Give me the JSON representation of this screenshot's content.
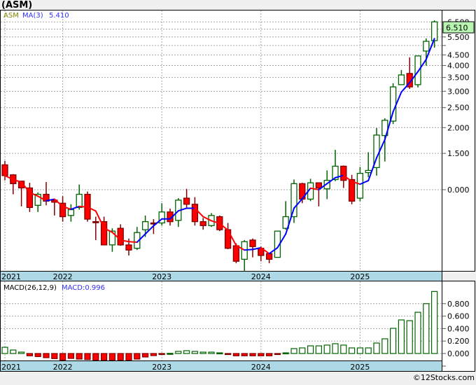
{
  "title": "(ASM)",
  "footer": "©12Stocks.com",
  "colors": {
    "up": "#006400",
    "down": "#ff0000",
    "down_border": "#800000",
    "ma_up": "#0000ff",
    "ma_down": "#ff0000",
    "date_bar": "#add8e6",
    "last_price_box": "#b8f5b0"
  },
  "chart_data": [
    {
      "type": "candlestick",
      "legend": {
        "symbol": "ASM",
        "ma_label": "MA(3)",
        "ma_value": "5.410"
      },
      "last_price": "6.510",
      "y_scale": "log",
      "grid": true,
      "x_tick_labels": [
        "2021",
        "2022",
        "2023",
        "2024",
        "2025"
      ],
      "x_ticks": [
        "2021-06",
        "2022-01",
        "2023-01",
        "2024-01",
        "2025-01"
      ],
      "y_ticks": [
        {
          "value": 6.5,
          "label": "6.500"
        },
        {
          "value": 6.0,
          "label": ""
        },
        {
          "value": 5.5,
          "label": "5.500"
        },
        {
          "value": 5.0,
          "label": ""
        },
        {
          "value": 4.5,
          "label": "4.500"
        },
        {
          "value": 4.0,
          "label": "4.000"
        },
        {
          "value": 3.5,
          "label": "3.500"
        },
        {
          "value": 3.0,
          "label": "3.000"
        },
        {
          "value": 2.5,
          "label": "2.500"
        },
        {
          "value": 2.0,
          "label": "2.000"
        },
        {
          "value": 1.5,
          "label": "1.500"
        },
        {
          "value": 1.0,
          "label": "0.000"
        }
      ],
      "ma_period": 3,
      "candles": [
        [
          "2021-06",
          1.32,
          1.38,
          1.11,
          1.17
        ],
        [
          "2021-07",
          1.18,
          1.19,
          0.95,
          1.07
        ],
        [
          "2021-08",
          1.1,
          1.1,
          0.83,
          1.02
        ],
        [
          "2021-09",
          1.02,
          1.08,
          0.78,
          0.82
        ],
        [
          "2021-10",
          0.84,
          0.97,
          0.78,
          0.95
        ],
        [
          "2021-11",
          0.95,
          1.09,
          0.84,
          0.88
        ],
        [
          "2021-12",
          0.89,
          0.9,
          0.75,
          0.87
        ],
        [
          "2022-01",
          0.86,
          0.93,
          0.7,
          0.74
        ],
        [
          "2022-02",
          0.75,
          0.85,
          0.7,
          0.8
        ],
        [
          "2022-03",
          0.82,
          1.06,
          0.8,
          0.95
        ],
        [
          "2022-04",
          0.95,
          0.98,
          0.7,
          0.72
        ],
        [
          "2022-05",
          0.7,
          0.74,
          0.57,
          0.695
        ],
        [
          "2022-06",
          0.7,
          0.74,
          0.54,
          0.54
        ],
        [
          "2022-07",
          0.54,
          0.65,
          0.5,
          0.63
        ],
        [
          "2022-08",
          0.65,
          0.68,
          0.535,
          0.54
        ],
        [
          "2022-09",
          0.54,
          0.58,
          0.48,
          0.51
        ],
        [
          "2022-10",
          0.52,
          0.66,
          0.51,
          0.62
        ],
        [
          "2022-11",
          0.64,
          0.75,
          0.59,
          0.7
        ],
        [
          "2022-12",
          0.69,
          0.72,
          0.61,
          0.685
        ],
        [
          "2023-01",
          0.69,
          0.86,
          0.67,
          0.78
        ],
        [
          "2023-02",
          0.78,
          0.81,
          0.67,
          0.7
        ],
        [
          "2023-03",
          0.71,
          0.91,
          0.66,
          0.89
        ],
        [
          "2023-04",
          0.91,
          1.01,
          0.82,
          0.85
        ],
        [
          "2023-05",
          0.85,
          0.92,
          0.67,
          0.7
        ],
        [
          "2023-06",
          0.7,
          0.73,
          0.64,
          0.67
        ],
        [
          "2023-07",
          0.67,
          0.77,
          0.66,
          0.75
        ],
        [
          "2023-08",
          0.74,
          0.75,
          0.63,
          0.64
        ],
        [
          "2023-09",
          0.64,
          0.69,
          0.515,
          0.52
        ],
        [
          "2023-10",
          0.535,
          0.55,
          0.44,
          0.45
        ],
        [
          "2023-11",
          0.46,
          0.57,
          0.4,
          0.56
        ],
        [
          "2023-12",
          0.57,
          0.58,
          0.47,
          0.53
        ],
        [
          "2024-01",
          0.52,
          0.53,
          0.45,
          0.48
        ],
        [
          "2024-02",
          0.49,
          0.49,
          0.44,
          0.46
        ],
        [
          "2024-03",
          0.47,
          0.63,
          0.47,
          0.63
        ],
        [
          "2024-04",
          0.65,
          0.88,
          0.64,
          0.74
        ],
        [
          "2024-05",
          0.74,
          1.12,
          0.69,
          1.07
        ],
        [
          "2024-06",
          1.07,
          1.08,
          0.86,
          0.9
        ],
        [
          "2024-07",
          0.9,
          1.13,
          0.88,
          1.08
        ],
        [
          "2024-08",
          1.08,
          1.08,
          0.83,
          1.02
        ],
        [
          "2024-09",
          1.01,
          1.24,
          0.9,
          1.11
        ],
        [
          "2024-10",
          1.12,
          1.56,
          1.1,
          1.3
        ],
        [
          "2024-11",
          1.3,
          1.31,
          1.02,
          1.11
        ],
        [
          "2024-12",
          1.12,
          1.18,
          0.85,
          0.88
        ],
        [
          "2025-01",
          0.91,
          1.29,
          0.88,
          1.2
        ],
        [
          "2025-02",
          1.21,
          1.52,
          1.15,
          1.24
        ],
        [
          "2025-03",
          1.28,
          1.99,
          1.17,
          1.84
        ],
        [
          "2025-04",
          1.83,
          2.22,
          1.37,
          2.17
        ],
        [
          "2025-05",
          2.15,
          3.28,
          2.08,
          3.15
        ],
        [
          "2025-06",
          3.23,
          3.8,
          3.23,
          3.6
        ],
        [
          "2025-07",
          3.66,
          4.38,
          3.08,
          3.15
        ],
        [
          "2025-08",
          3.23,
          4.45,
          3.13,
          4.45
        ],
        [
          "2025-09",
          4.7,
          5.41,
          3.99,
          5.24
        ],
        [
          "2025-10",
          5.28,
          6.62,
          4.88,
          6.51
        ]
      ]
    },
    {
      "type": "bar",
      "legend": {
        "label": "MACD(26,12,9)",
        "value_label": "MACD:0.996"
      },
      "y_ticks": [
        {
          "value": 0.8,
          "label": "0.800"
        },
        {
          "value": 0.6,
          "label": "0.600"
        },
        {
          "value": 0.4,
          "label": "0.400"
        },
        {
          "value": 0.2,
          "label": "0.200"
        },
        {
          "value": 0.0,
          "label": "0.000"
        }
      ],
      "x_tick_labels": [
        "2021",
        "2022",
        "2023",
        "2024",
        "2025"
      ],
      "values": [
        0.1,
        0.056,
        0.022,
        -0.037,
        -0.049,
        -0.067,
        -0.082,
        -0.105,
        -0.079,
        -0.09,
        -0.097,
        -0.108,
        -0.108,
        -0.108,
        -0.108,
        -0.108,
        -0.09,
        -0.056,
        -0.034,
        -0.011,
        0.003,
        0.034,
        0.045,
        0.034,
        0.022,
        0.022,
        0.011,
        -0.015,
        -0.037,
        -0.037,
        -0.037,
        -0.037,
        -0.037,
        -0.015,
        0.011,
        0.079,
        0.09,
        0.123,
        0.123,
        0.135,
        0.157,
        0.135,
        0.09,
        0.09,
        0.09,
        0.168,
        0.236,
        0.404,
        0.539,
        0.527,
        0.662,
        0.8,
        0.996
      ]
    }
  ]
}
